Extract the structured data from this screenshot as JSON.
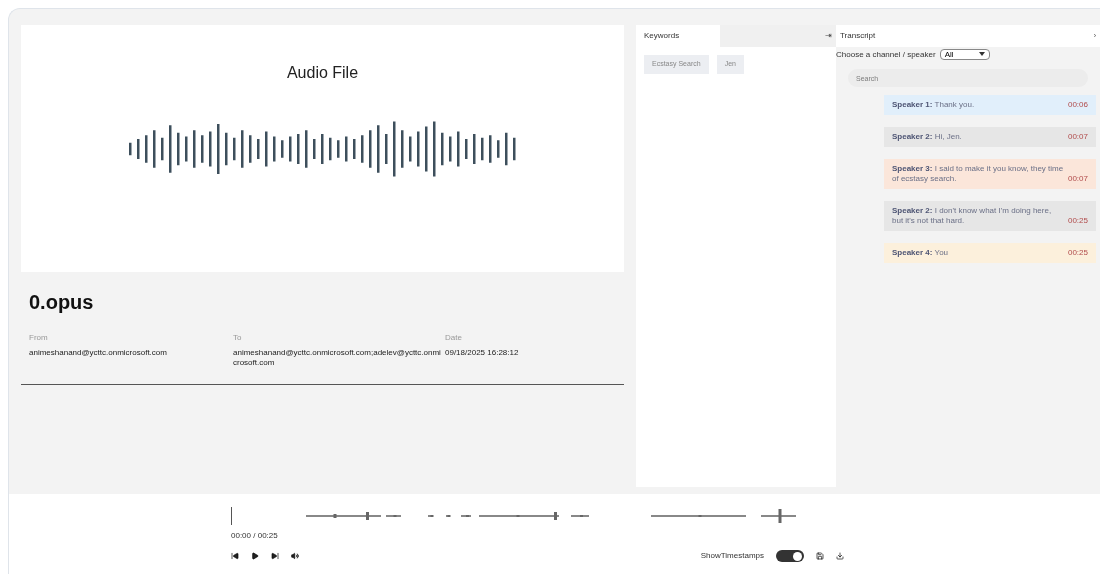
{
  "audio_card": {
    "title": "Audio File"
  },
  "file": {
    "name": "0.opus",
    "fields": [
      {
        "label": "From",
        "value": "animeshanand@ycttc.onmicrosoft.com"
      },
      {
        "label": "To",
        "value": "animeshanand@ycttc.onmicrosoft.com;adelev@ycttc.onmicrosoft.com"
      },
      {
        "label": "Date",
        "value": "09/18/2025 16:28:12"
      }
    ]
  },
  "keywords": {
    "tab": "Keywords",
    "arrow": "⇥",
    "items": [
      "Ecstasy Search",
      "Jen"
    ]
  },
  "transcript": {
    "tab": "Transcript",
    "arrow": "›",
    "filter_label": "Choose a channel / speaker",
    "filter_value": "All",
    "search": {
      "placeholder": "Search"
    },
    "entries": [
      {
        "speaker": "Speaker 1:",
        "text": "Thank you.",
        "time": "00:06",
        "color": "#e1effb"
      },
      {
        "speaker": "Speaker 2:",
        "text": "Hi, Jen.",
        "time": "00:07",
        "color": "#e6e6e6"
      },
      {
        "speaker": "Speaker 3:",
        "text": "I said to make it you know, they time of ecstasy search.",
        "time": "00:07",
        "color": "#fbe6da"
      },
      {
        "speaker": "Speaker 2:",
        "text": "I don't know what I'm doing here, but it's not that hard.",
        "time": "00:25",
        "color": "#e6e6e6"
      },
      {
        "speaker": "Speaker 4:",
        "text": "You",
        "time": "00:25",
        "color": "#fcf0dc"
      }
    ]
  },
  "player": {
    "time": "00:00 / 00:25",
    "timestamps_label": "ShowTimestamps",
    "show_timestamps": true
  }
}
